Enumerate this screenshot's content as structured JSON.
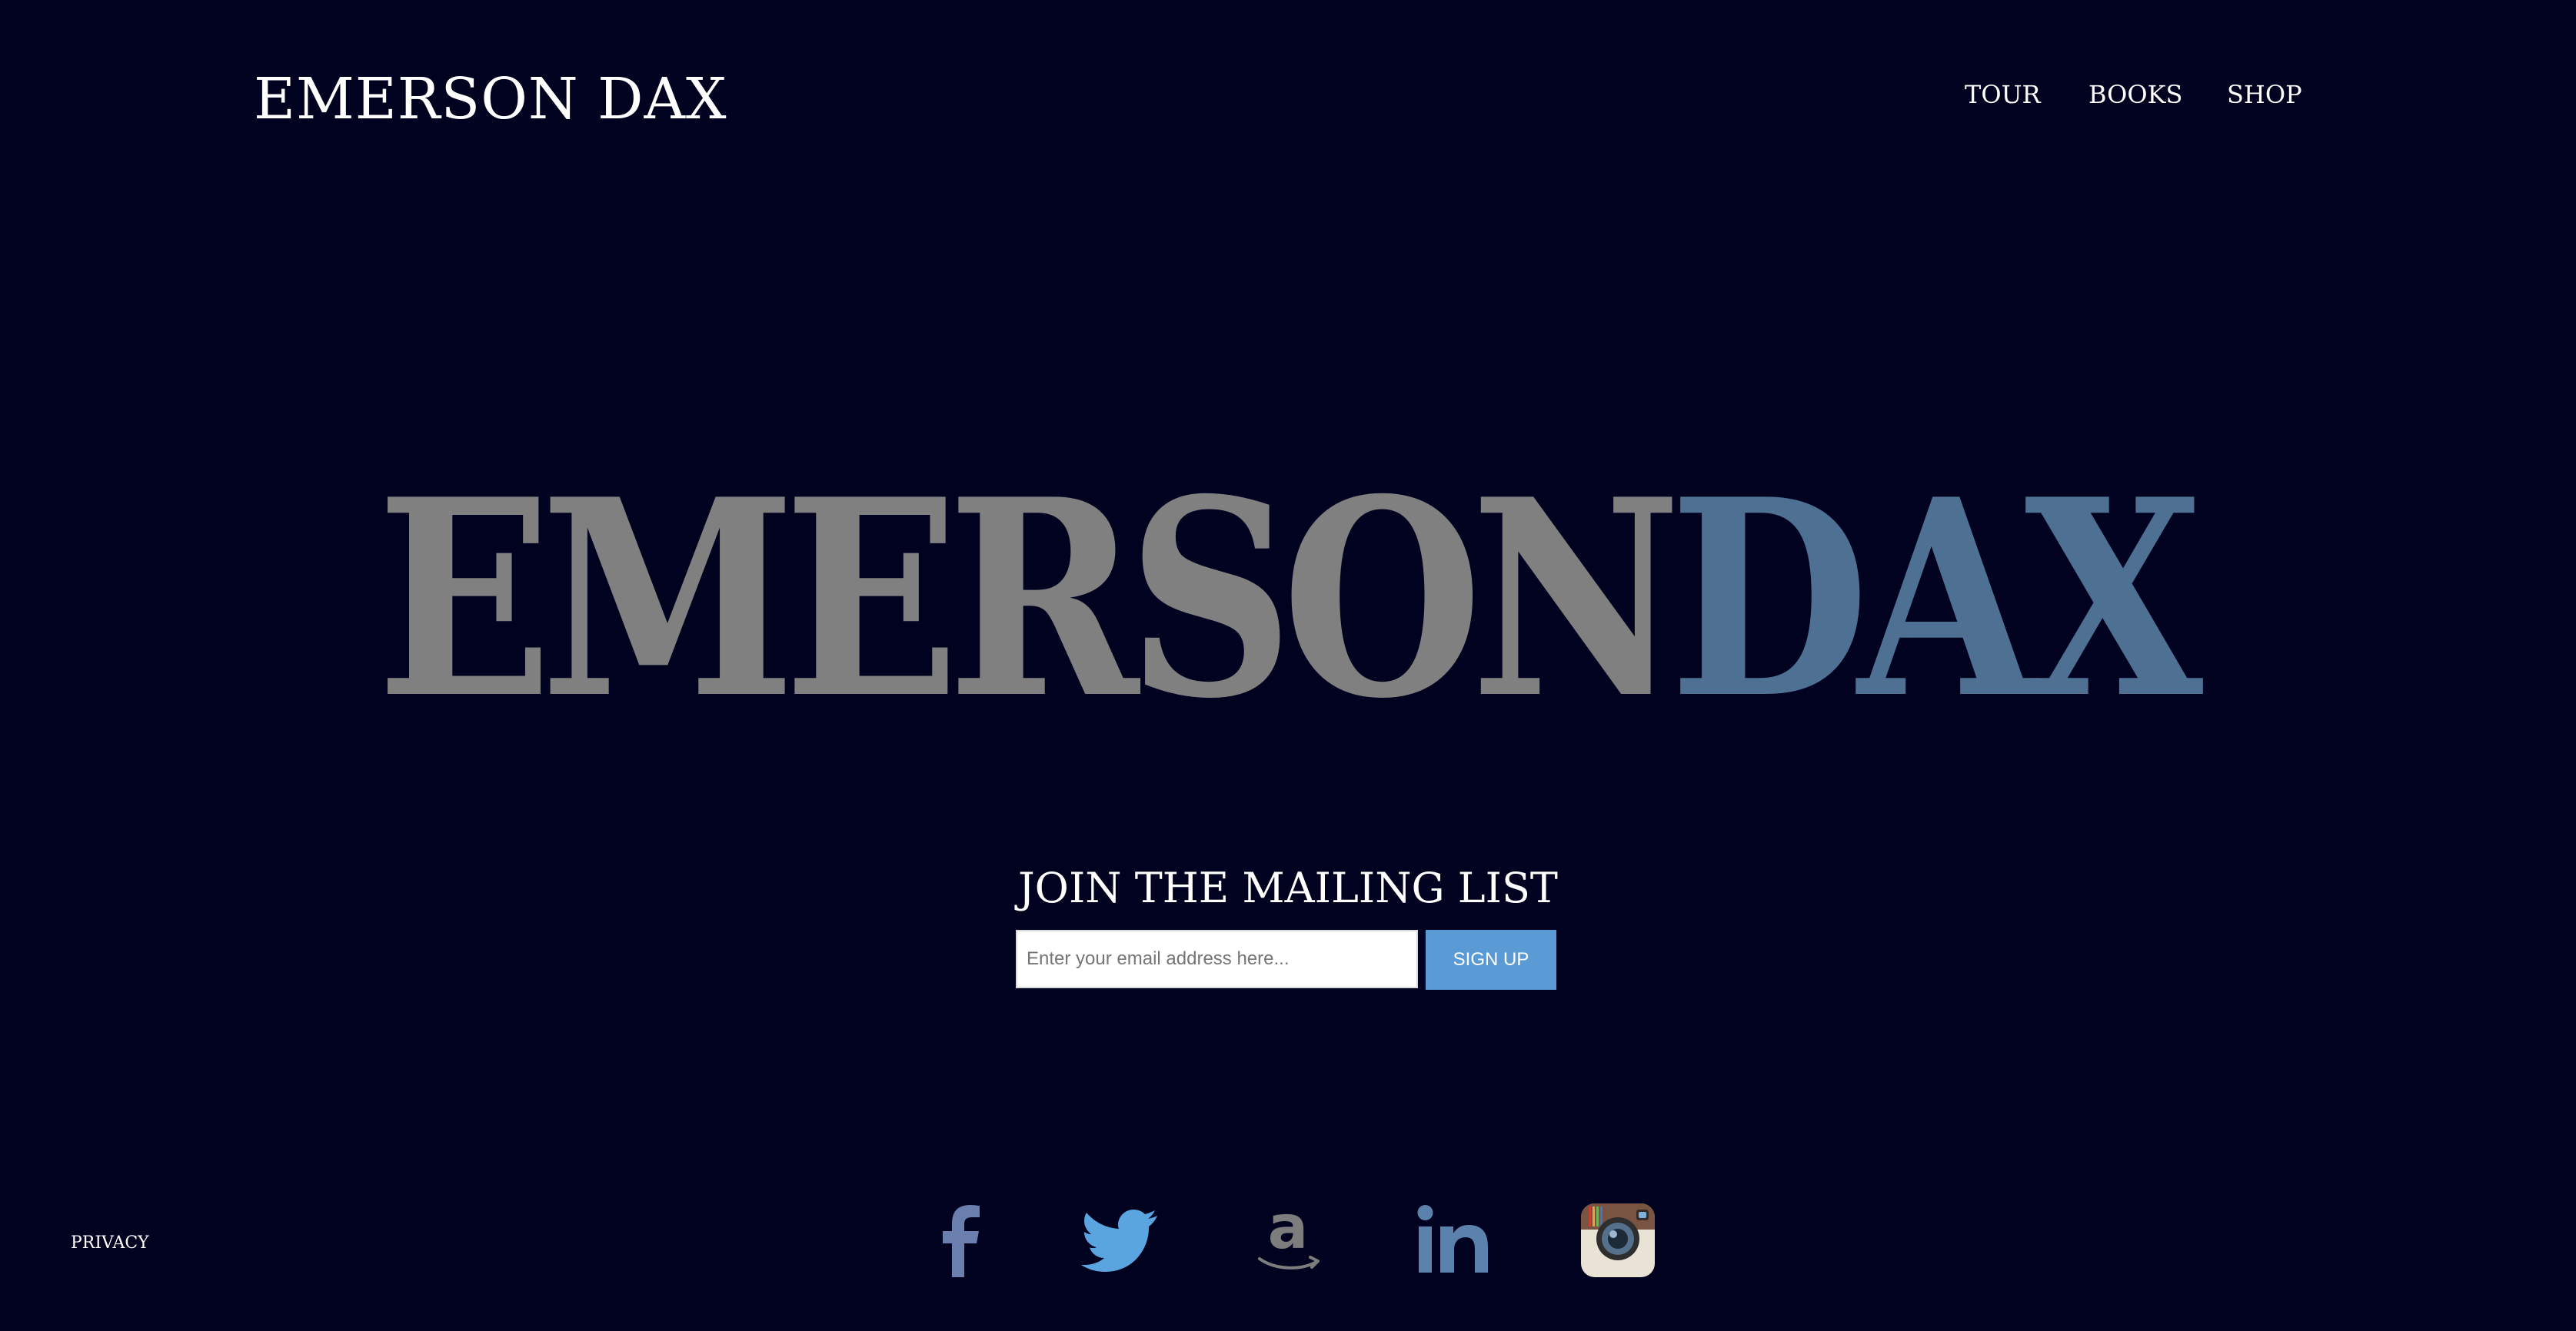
{
  "header": {
    "site_title": "EMERSON DAX",
    "nav": {
      "tour": "TOUR",
      "books": "BOOKS",
      "shop": "SHOP"
    }
  },
  "hero": {
    "first": "EMERSON",
    "last": "DAX",
    "colors": {
      "first": "#808080",
      "last": "#4e7193"
    }
  },
  "mailing_list": {
    "heading": "JOIN THE MAILING LIST",
    "email_placeholder": "Enter your email address here...",
    "signup_label": "SIGN UP",
    "button_color": "#5b9bd5"
  },
  "footer": {
    "privacy_label": "PRIVACY",
    "social_icons": [
      "facebook-icon",
      "twitter-icon",
      "amazon-icon",
      "linkedin-icon",
      "instagram-icon"
    ]
  },
  "colors": {
    "background": "#010220",
    "text": "#ffffff"
  }
}
